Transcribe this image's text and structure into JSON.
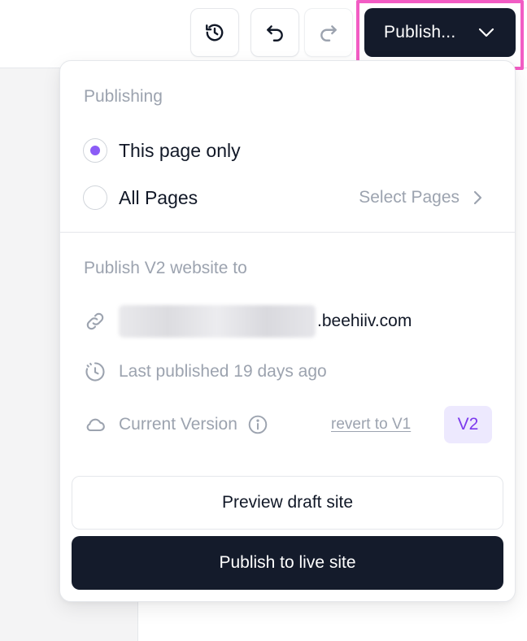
{
  "toolbar": {
    "history_icon": "history-icon",
    "undo_icon": "undo-icon",
    "redo_icon": "redo-icon",
    "publish_label": "Publish...",
    "publish_chevron_icon": "chevron-down-icon"
  },
  "publishing": {
    "section_label": "Publishing",
    "options": [
      {
        "label": "This page only",
        "checked": true
      },
      {
        "label": "All Pages",
        "checked": false
      }
    ],
    "select_pages_label": "Select Pages"
  },
  "target": {
    "section_label": "Publish V2 website to",
    "domain_suffix": ".beehiiv.com",
    "last_published": "Last published 19 days ago",
    "current_version_label": "Current Version",
    "revert_label": "revert to V1",
    "version_badge": "V2"
  },
  "actions": {
    "preview_label": "Preview draft site",
    "publish_live_label": "Publish to live site"
  },
  "colors": {
    "primary_dark": "#141b2b",
    "accent_purple": "#8b5cf6",
    "badge_bg": "#ede9fe",
    "highlight_pink": "#f25cc4",
    "muted_text": "#9ca3af"
  }
}
